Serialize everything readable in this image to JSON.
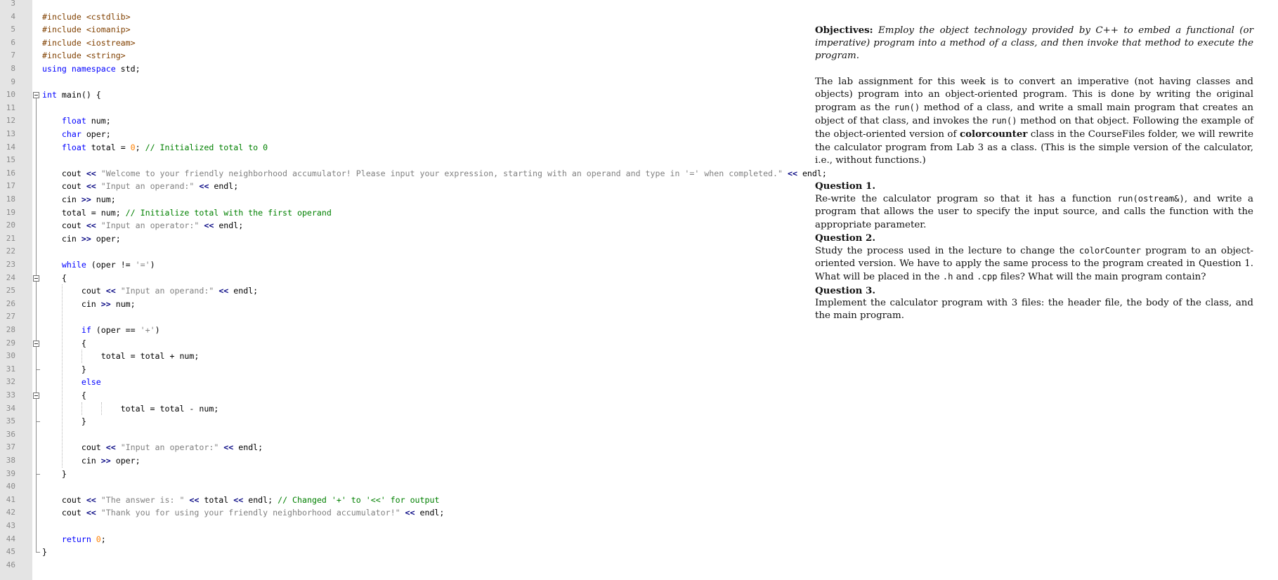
{
  "editor": {
    "first_line_number": 3,
    "lines": [
      [],
      [
        {
          "t": "#include <cstdlib>",
          "c": "pp"
        }
      ],
      [
        {
          "t": "#include <iomanip>",
          "c": "pp"
        }
      ],
      [
        {
          "t": "#include <iostream>",
          "c": "pp"
        }
      ],
      [
        {
          "t": "#include <string>",
          "c": "pp"
        }
      ],
      [
        {
          "t": "using namespace",
          "c": "kw"
        },
        {
          "t": " std;",
          "c": "plain"
        }
      ],
      [],
      [
        {
          "t": "int",
          "c": "kw"
        },
        {
          "t": " main() {",
          "c": "plain"
        }
      ],
      [],
      [
        {
          "t": "    float",
          "c": "kw"
        },
        {
          "t": " num;",
          "c": "plain"
        }
      ],
      [
        {
          "t": "    char",
          "c": "kw"
        },
        {
          "t": " oper;",
          "c": "plain"
        }
      ],
      [
        {
          "t": "    float",
          "c": "kw"
        },
        {
          "t": " total = ",
          "c": "plain"
        },
        {
          "t": "0",
          "c": "num"
        },
        {
          "t": "; ",
          "c": "plain"
        },
        {
          "t": "// Initialized total to 0",
          "c": "cmt"
        }
      ],
      [],
      [
        {
          "t": "    cout ",
          "c": "plain"
        },
        {
          "t": "<<",
          "c": "op"
        },
        {
          "t": " \"Welcome to your friendly neighborhood accumulator! Please input your expression, starting with an operand and type in '=' when completed.\"",
          "c": "str"
        },
        {
          "t": " ",
          "c": "plain"
        },
        {
          "t": "<<",
          "c": "op"
        },
        {
          "t": " endl;",
          "c": "plain"
        }
      ],
      [
        {
          "t": "    cout ",
          "c": "plain"
        },
        {
          "t": "<<",
          "c": "op"
        },
        {
          "t": " \"Input an operand:\"",
          "c": "str"
        },
        {
          "t": " ",
          "c": "plain"
        },
        {
          "t": "<<",
          "c": "op"
        },
        {
          "t": " endl;",
          "c": "plain"
        }
      ],
      [
        {
          "t": "    cin ",
          "c": "plain"
        },
        {
          "t": ">>",
          "c": "op"
        },
        {
          "t": " num;",
          "c": "plain"
        }
      ],
      [
        {
          "t": "    total = num; ",
          "c": "plain"
        },
        {
          "t": "// Initialize total with the first operand",
          "c": "cmt"
        }
      ],
      [
        {
          "t": "    cout ",
          "c": "plain"
        },
        {
          "t": "<<",
          "c": "op"
        },
        {
          "t": " \"Input an operator:\"",
          "c": "str"
        },
        {
          "t": " ",
          "c": "plain"
        },
        {
          "t": "<<",
          "c": "op"
        },
        {
          "t": " endl;",
          "c": "plain"
        }
      ],
      [
        {
          "t": "    cin ",
          "c": "plain"
        },
        {
          "t": ">>",
          "c": "op"
        },
        {
          "t": " oper;",
          "c": "plain"
        }
      ],
      [],
      [
        {
          "t": "    while",
          "c": "kw"
        },
        {
          "t": " (oper != ",
          "c": "plain"
        },
        {
          "t": "'='",
          "c": "str"
        },
        {
          "t": ")",
          "c": "plain"
        }
      ],
      [
        {
          "t": "    {",
          "c": "plain"
        }
      ],
      [
        {
          "t": "        cout ",
          "c": "plain"
        },
        {
          "t": "<<",
          "c": "op"
        },
        {
          "t": " \"Input an operand:\"",
          "c": "str"
        },
        {
          "t": " ",
          "c": "plain"
        },
        {
          "t": "<<",
          "c": "op"
        },
        {
          "t": " endl;",
          "c": "plain"
        }
      ],
      [
        {
          "t": "        cin ",
          "c": "plain"
        },
        {
          "t": ">>",
          "c": "op"
        },
        {
          "t": " num;",
          "c": "plain"
        }
      ],
      [],
      [
        {
          "t": "        if",
          "c": "kw"
        },
        {
          "t": " (oper == ",
          "c": "plain"
        },
        {
          "t": "'+'",
          "c": "str"
        },
        {
          "t": ")",
          "c": "plain"
        }
      ],
      [
        {
          "t": "        {",
          "c": "plain"
        }
      ],
      [
        {
          "t": "            total = total + num;",
          "c": "plain"
        }
      ],
      [
        {
          "t": "        }",
          "c": "plain"
        }
      ],
      [
        {
          "t": "        else",
          "c": "kw"
        }
      ],
      [
        {
          "t": "        {",
          "c": "plain"
        }
      ],
      [
        {
          "t": "                total = total - num;",
          "c": "plain"
        }
      ],
      [
        {
          "t": "        }",
          "c": "plain"
        }
      ],
      [],
      [
        {
          "t": "        cout ",
          "c": "plain"
        },
        {
          "t": "<<",
          "c": "op"
        },
        {
          "t": " \"Input an operator:\"",
          "c": "str"
        },
        {
          "t": " ",
          "c": "plain"
        },
        {
          "t": "<<",
          "c": "op"
        },
        {
          "t": " endl;",
          "c": "plain"
        }
      ],
      [
        {
          "t": "        cin ",
          "c": "plain"
        },
        {
          "t": ">>",
          "c": "op"
        },
        {
          "t": " oper;",
          "c": "plain"
        }
      ],
      [
        {
          "t": "    }",
          "c": "plain"
        }
      ],
      [],
      [
        {
          "t": "    cout ",
          "c": "plain"
        },
        {
          "t": "<<",
          "c": "op"
        },
        {
          "t": " \"The answer is: \"",
          "c": "str"
        },
        {
          "t": " ",
          "c": "plain"
        },
        {
          "t": "<<",
          "c": "op"
        },
        {
          "t": " total ",
          "c": "plain"
        },
        {
          "t": "<<",
          "c": "op"
        },
        {
          "t": " endl; ",
          "c": "plain"
        },
        {
          "t": "// Changed '+' to '<<' for output",
          "c": "cmt"
        }
      ],
      [
        {
          "t": "    cout ",
          "c": "plain"
        },
        {
          "t": "<<",
          "c": "op"
        },
        {
          "t": " \"Thank you for using your friendly neighborhood accumulator!\"",
          "c": "str"
        },
        {
          "t": " ",
          "c": "plain"
        },
        {
          "t": "<<",
          "c": "op"
        },
        {
          "t": " endl;",
          "c": "plain"
        }
      ],
      [],
      [
        {
          "t": "    return",
          "c": "kw"
        },
        {
          "t": " ",
          "c": "plain"
        },
        {
          "t": "0",
          "c": "num"
        },
        {
          "t": ";",
          "c": "plain"
        }
      ],
      [
        {
          "t": "}",
          "c": "plain"
        }
      ],
      []
    ]
  },
  "doc": {
    "objectives_label": "Objectives:",
    "objectives_text": "Employ the object technology provided by C++ to embed a functional (or imperative) program into a method of a class, and then invoke that method to execute the program.",
    "intro": {
      "p1": "The lab assignment for this week is to convert an imperative (not having classes and objects) program into an object-oriented program.  This is done by writing the original program as the ",
      "run1": "run()",
      "p2": " method of a class, and write a small main program that creates an object of that class, and invokes the ",
      "run2": "run()",
      "p3": " method on that object. Following the example of the object-oriented version of ",
      "colorcounter": "colorcounter",
      "p4": " class in the CourseFiles folder, we will rewrite the calculator program from Lab 3 as a class. (This is the simple version of the calculator, i.e., without functions.)"
    },
    "q1": {
      "heading": "Question 1.",
      "t1": "Re-write the calculator program so that it has a function ",
      "code": "run(ostream&)",
      "t2": ", and write a program that allows the user to specify the input source, and calls the function with the appropriate parameter."
    },
    "q2": {
      "heading": "Question 2.",
      "t1": "Study the process used in the lecture to change the ",
      "code1": "colorCounter",
      "t2": " program to an object-oriented version. We have to apply the same process to the program created in Question 1. What will be placed in the ",
      "code2": ".h",
      "t3": " and ",
      "code3": ".cpp",
      "t4": " files? What will the main program contain?"
    },
    "q3": {
      "heading": "Question 3.",
      "t1": "Implement the calculator program with 3 files: the header file, the body of the class, and the main program."
    }
  }
}
